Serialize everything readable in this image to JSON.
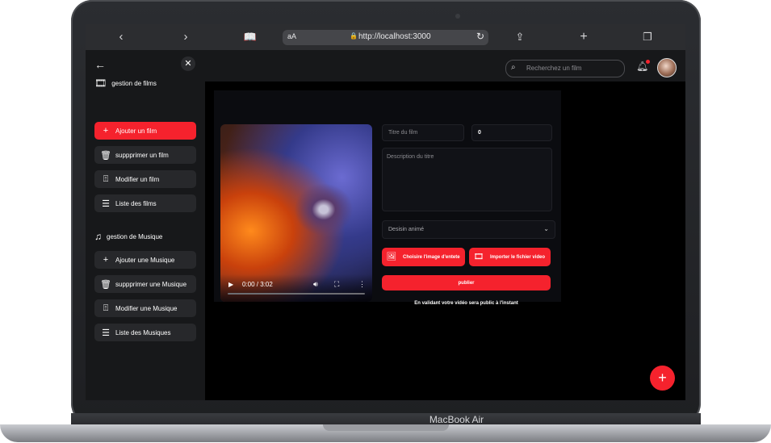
{
  "device": {
    "brand_label": "MacBook Air"
  },
  "browser": {
    "reader_label": "aA",
    "url": "http://localhost:3000",
    "icons": [
      "back-icon",
      "forward-icon",
      "bookmarks-icon",
      "lock-icon",
      "reload-icon",
      "share-icon",
      "new-tab-icon",
      "tabs-icon"
    ]
  },
  "sidebar": {
    "back_icon": "arrow-left-icon",
    "close_icon": "close-icon",
    "films_section": {
      "title": "gestion de films",
      "items": [
        {
          "label": "Ajouter un film",
          "icon": "plus-icon",
          "active": true
        },
        {
          "label": "suppprimer un film",
          "icon": "trash-icon",
          "active": false
        },
        {
          "label": "Modifier un film",
          "icon": "upload-box-icon",
          "active": false
        },
        {
          "label": "Liste des films",
          "icon": "list-icon",
          "active": false
        }
      ]
    },
    "music_section": {
      "title": "gestion de Musique",
      "items": [
        {
          "label": "Ajouter une Musique",
          "icon": "plus-icon",
          "active": false
        },
        {
          "label": "suppprimer une Musique",
          "icon": "trash-icon",
          "active": false
        },
        {
          "label": "Modifier une Musique",
          "icon": "upload-box-icon",
          "active": false
        },
        {
          "label": "Liste des Musiques",
          "icon": "list-icon",
          "active": false
        }
      ]
    }
  },
  "header": {
    "search_placeholder": "Recherchez un film",
    "notification_icon": "bell-icon"
  },
  "player": {
    "time": "0:00 / 3:02",
    "progress": 0
  },
  "form": {
    "title_placeholder": "Titre du film",
    "number_value": "0",
    "description_placeholder": "Description du titre",
    "category_selected": "Desisin animé",
    "image_button": "Choisire l'image d'entete",
    "video_button": "Importer le fichier video",
    "publish_button": "publier",
    "notice": "En validant votre vidéo sera public à l'instant"
  },
  "colors": {
    "accent": "#f5222d",
    "sidebar": "#17181a",
    "background": "#000000"
  }
}
